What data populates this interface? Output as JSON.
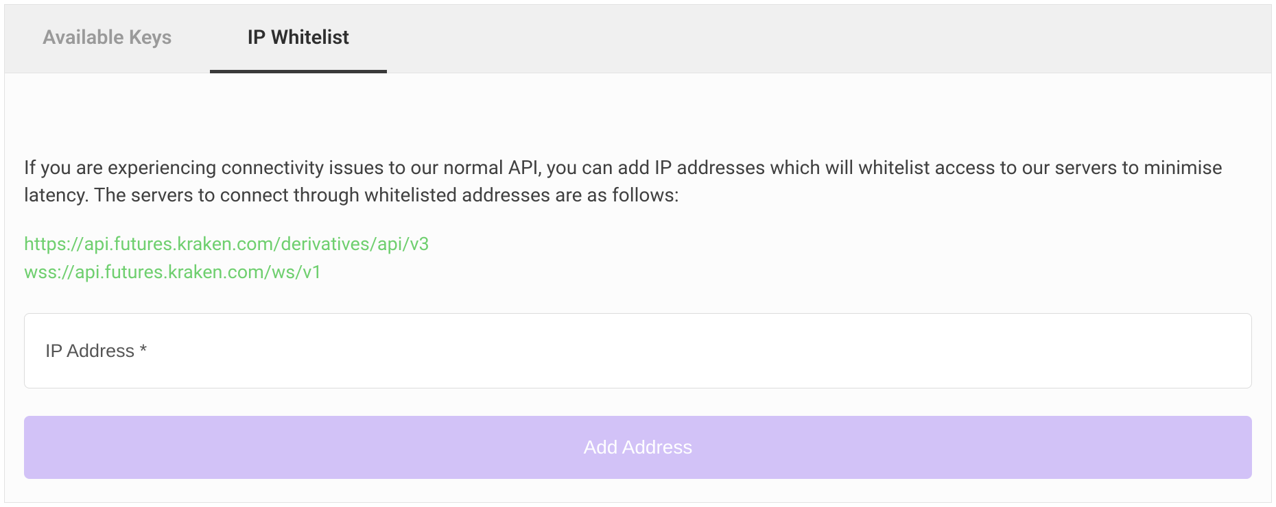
{
  "tabs": {
    "available_keys": "Available Keys",
    "ip_whitelist": "IP Whitelist"
  },
  "content": {
    "description": "If you are experiencing connectivity issues to our normal API, you can add IP addresses which will whitelist access to our servers to minimise latency. The servers to connect through whitelisted addresses are as follows:",
    "link1": "https://api.futures.kraken.com/derivatives/api/v3",
    "link2": "wss://api.futures.kraken.com/ws/v1",
    "ip_placeholder": "IP Address *",
    "add_button": "Add Address"
  }
}
